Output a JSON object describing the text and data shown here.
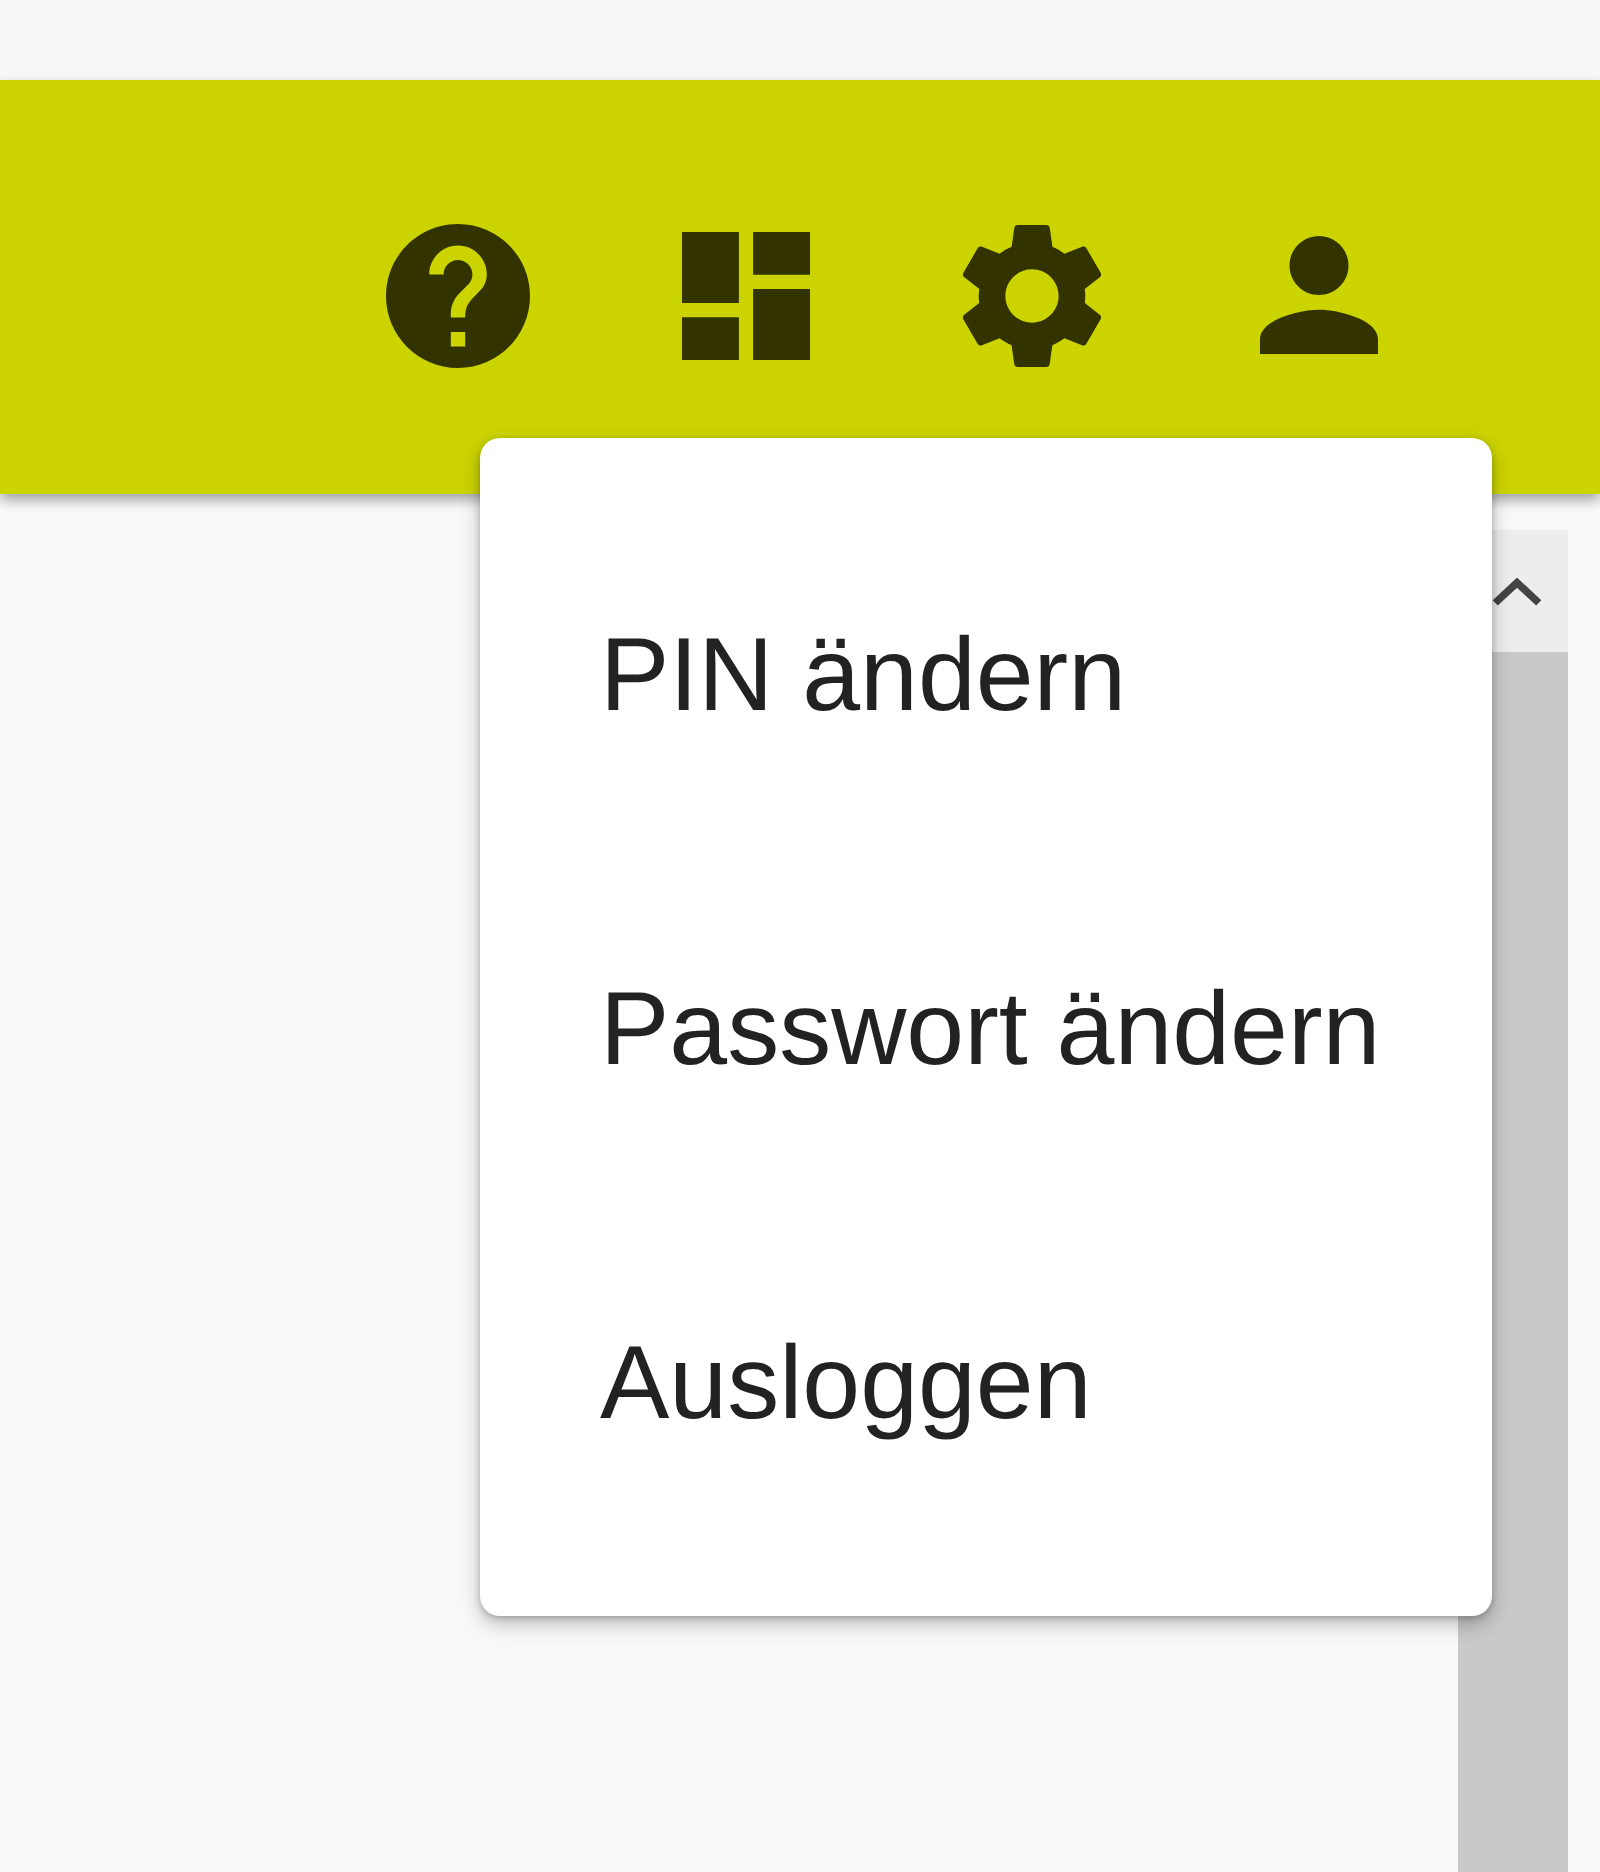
{
  "user_menu": {
    "items": [
      {
        "label": "PIN ändern"
      },
      {
        "label": "Passwort ändern"
      },
      {
        "label": "Ausloggen"
      }
    ]
  }
}
